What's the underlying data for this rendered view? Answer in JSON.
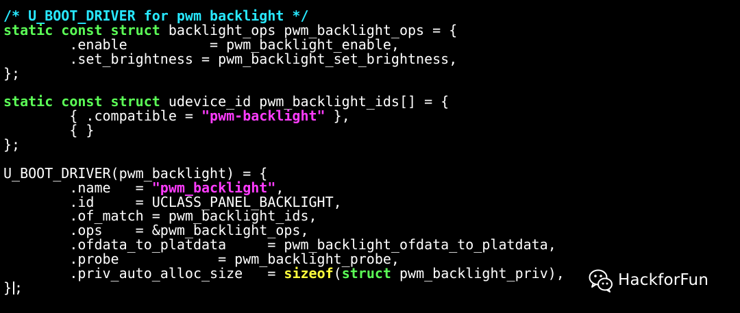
{
  "editor": {
    "lines": [
      [
        {
          "cls": "comment",
          "text": "/* U_BOOT_DRIVER for pwm backlight */"
        }
      ],
      [
        {
          "cls": "keyword",
          "text": "static const struct"
        },
        {
          "cls": "plain",
          "text": " backlight_ops pwm_backlight_ops = {"
        }
      ],
      [
        {
          "cls": "plain",
          "text": "        .enable          = pwm_backlight_enable,"
        }
      ],
      [
        {
          "cls": "plain",
          "text": "        .set_brightness = pwm_backlight_set_brightness,"
        }
      ],
      [
        {
          "cls": "plain",
          "text": "};"
        }
      ],
      [],
      [
        {
          "cls": "keyword",
          "text": "static const struct"
        },
        {
          "cls": "plain",
          "text": " udevice_id pwm_backlight_ids[] = {"
        }
      ],
      [
        {
          "cls": "plain",
          "text": "        { .compatible = "
        },
        {
          "cls": "string",
          "text": "\"pwm-backlight\""
        },
        {
          "cls": "plain",
          "text": " },"
        }
      ],
      [
        {
          "cls": "plain",
          "text": "        { }"
        }
      ],
      [
        {
          "cls": "plain",
          "text": "};"
        }
      ],
      [],
      [
        {
          "cls": "plain",
          "text": "U_BOOT_DRIVER(pwm_backlight) = {"
        }
      ],
      [
        {
          "cls": "plain",
          "text": "        .name   = "
        },
        {
          "cls": "string",
          "text": "\"pwm_backlight\""
        },
        {
          "cls": "plain",
          "text": ","
        }
      ],
      [
        {
          "cls": "plain",
          "text": "        .id     = UCLASS_PANEL_BACKLIGHT,"
        }
      ],
      [
        {
          "cls": "plain",
          "text": "        .of_match = pwm_backlight_ids,"
        }
      ],
      [
        {
          "cls": "plain",
          "text": "        .ops    = &pwm_backlight_ops,"
        }
      ],
      [
        {
          "cls": "plain",
          "text": "        .ofdata_to_platdata     = pwm_backlight_ofdata_to_platdata,"
        }
      ],
      [
        {
          "cls": "plain",
          "text": "        .probe            = pwm_backlight_probe,"
        }
      ],
      [
        {
          "cls": "plain",
          "text": "        .priv_auto_alloc_size   = "
        },
        {
          "cls": "builtin",
          "text": "sizeof"
        },
        {
          "cls": "plain",
          "text": "("
        },
        {
          "cls": "keyword",
          "text": "struct"
        },
        {
          "cls": "plain",
          "text": " pwm_backlight_priv),"
        }
      ],
      [
        {
          "cls": "plain",
          "text": "}"
        },
        {
          "cls": "cursor",
          "text": ""
        },
        {
          "cls": "plain",
          "text": ";"
        }
      ]
    ]
  },
  "watermark": {
    "text": "HackforFun",
    "icon": "wechat-icon"
  },
  "colors": {
    "background": "#000000",
    "comment": "#28e8ff",
    "keyword": "#5cff57",
    "string": "#ff3cff",
    "builtin": "#ffff3c",
    "plain": "#ffffff"
  }
}
